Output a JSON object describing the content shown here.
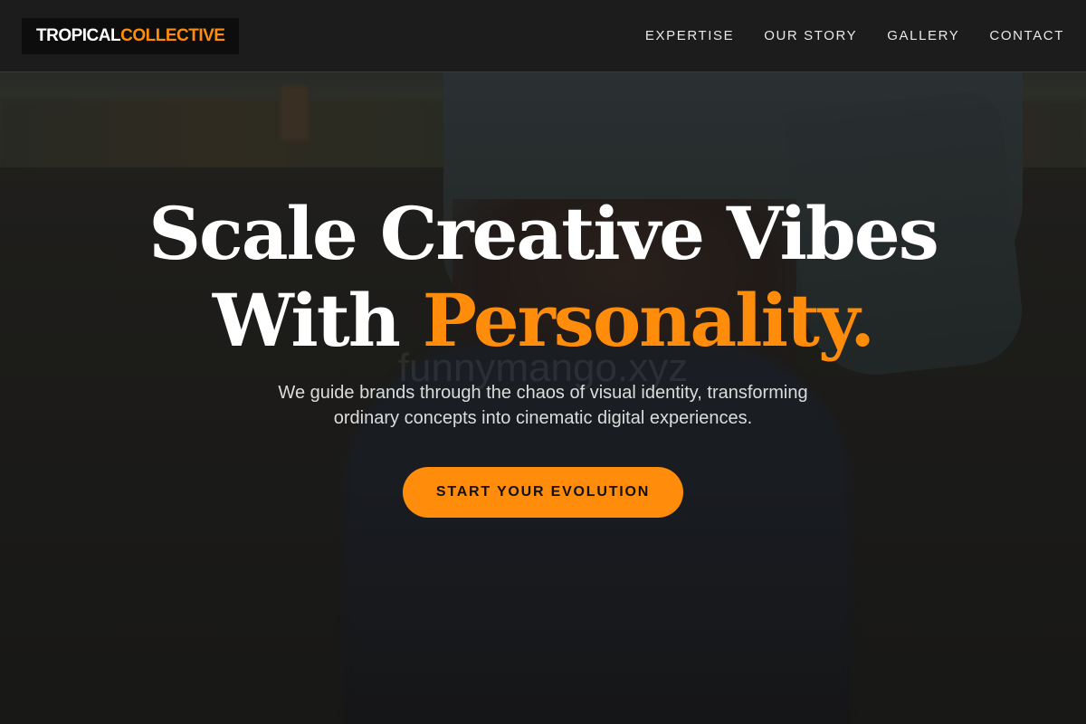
{
  "brand": {
    "logo_part1": "TROPICAL",
    "logo_part2": "COLLECTIVE"
  },
  "nav": {
    "items": [
      "EXPERTISE",
      "OUR STORY",
      "GALLERY",
      "CONTACT"
    ]
  },
  "hero": {
    "headline_line1": "Scale Creative Vibes",
    "headline_line2_prefix": "With ",
    "headline_line2_accent": "Personality.",
    "watermark": "funnymango.xyz",
    "subtitle": "We guide brands through the chaos of visual identity, transforming ordinary concepts into cinematic digital experiences.",
    "cta_label": "START YOUR EVOLUTION"
  },
  "colors": {
    "accent": "#ff8c0a",
    "header_bg": "#1c1c1c",
    "text": "#ffffff"
  }
}
